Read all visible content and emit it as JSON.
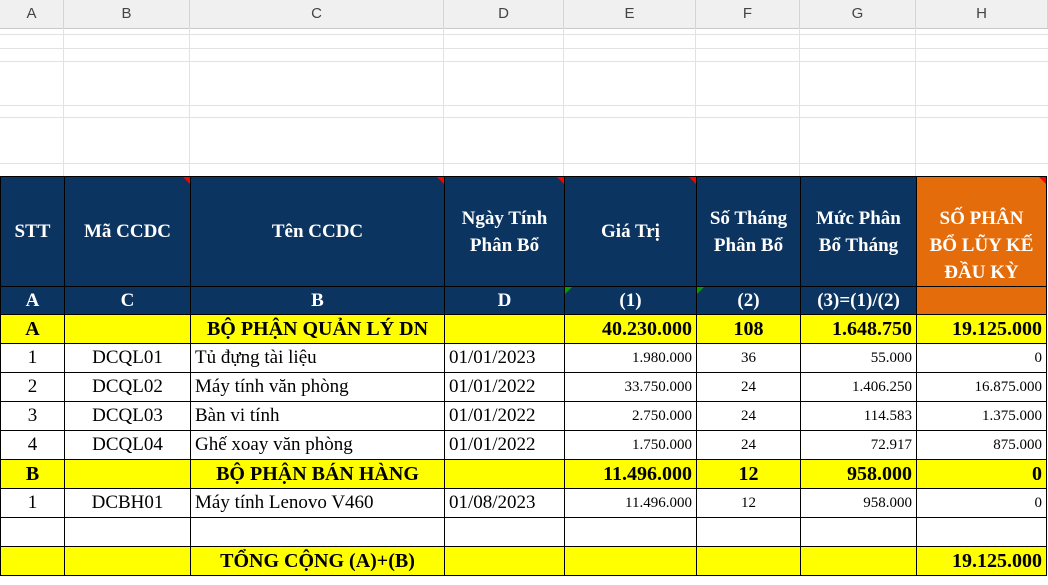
{
  "column_headers": [
    "A",
    "B",
    "C",
    "D",
    "E",
    "F",
    "G",
    "H"
  ],
  "table": {
    "header": {
      "stt": "STT",
      "ma": "Mã CCDC",
      "ten": "Tên CCDC",
      "ngay_1": "Ngày Tính",
      "ngay_2": "Phân Bổ",
      "gia_tri": "Giá Trị",
      "so_thang_1": "Số Tháng",
      "so_thang_2": "Phân Bổ",
      "muc_1": "Mức Phân",
      "muc_2": "Bổ Tháng",
      "luy_ke_1": "SỐ PHÂN",
      "luy_ke_2": "BỔ LŨY KẾ",
      "luy_ke_3": "ĐẦU KỲ"
    },
    "codes": [
      "A",
      "C",
      "B",
      "D",
      "(1)",
      "(2)",
      "(3)=(1)/(2)",
      ""
    ],
    "section_a": {
      "label": "A",
      "name": "BỘ PHẬN QUẢN LÝ DN",
      "gia_tri": "40.230.000",
      "so_thang": "108",
      "muc": "1.648.750",
      "luy_ke": "19.125.000"
    },
    "items_a": [
      {
        "stt": "1",
        "ma": "DCQL01",
        "ten": "Tủ đựng tài liệu",
        "ngay": "01/01/2023",
        "gia_tri": "1.980.000",
        "so_thang": "36",
        "muc": "55.000",
        "luy_ke": "0"
      },
      {
        "stt": "2",
        "ma": "DCQL02",
        "ten": "Máy tính văn phòng",
        "ngay": "01/01/2022",
        "gia_tri": "33.750.000",
        "so_thang": "24",
        "muc": "1.406.250",
        "luy_ke": "16.875.000"
      },
      {
        "stt": "3",
        "ma": "DCQL03",
        "ten": "Bàn vi tính",
        "ngay": "01/01/2022",
        "gia_tri": "2.750.000",
        "so_thang": "24",
        "muc": "114.583",
        "luy_ke": "1.375.000"
      },
      {
        "stt": "4",
        "ma": "DCQL04",
        "ten": "Ghế xoay văn phòng",
        "ngay": "01/01/2022",
        "gia_tri": "1.750.000",
        "so_thang": "24",
        "muc": "72.917",
        "luy_ke": "875.000"
      }
    ],
    "section_b": {
      "label": "B",
      "name": "BỘ PHẬN BÁN HÀNG",
      "gia_tri": "11.496.000",
      "so_thang": "12",
      "muc": "958.000",
      "luy_ke": "0"
    },
    "items_b": [
      {
        "stt": "1",
        "ma": "DCBH01",
        "ten": "Máy tính Lenovo V460",
        "ngay": "01/08/2023",
        "gia_tri": "11.496.000",
        "so_thang": "12",
        "muc": "958.000",
        "luy_ke": "0"
      }
    ],
    "total": {
      "label": "TỔNG CỘNG (A)+(B)",
      "luy_ke": "19.125.000"
    }
  }
}
